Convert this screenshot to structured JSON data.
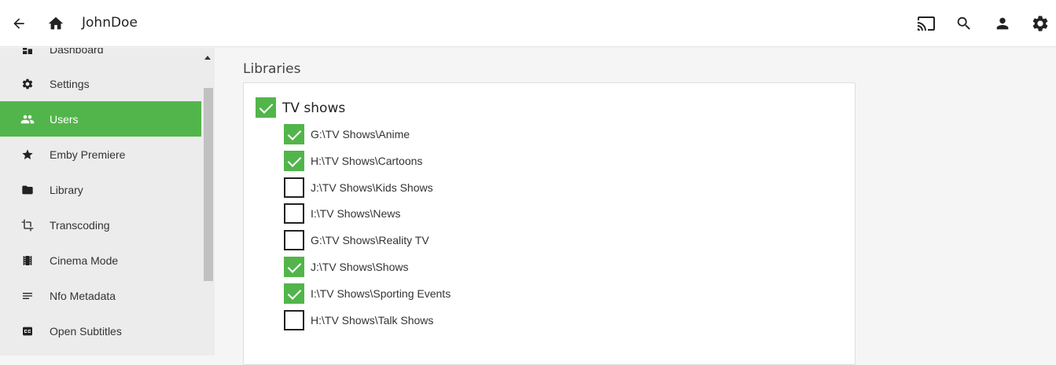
{
  "header": {
    "title": "JohnDoe",
    "icons": [
      "arrow-left-icon",
      "home-icon",
      "cast-icon",
      "search-icon",
      "person-icon",
      "gear-icon"
    ]
  },
  "sidebar": {
    "items": [
      {
        "label": "Dashboard",
        "icon": "dashboard-icon"
      },
      {
        "label": "Settings",
        "icon": "gear-icon"
      },
      {
        "label": "Users",
        "icon": "people-icon",
        "active": true
      },
      {
        "label": "Emby Premiere",
        "icon": "star-icon"
      },
      {
        "label": "Library",
        "icon": "folder-icon"
      },
      {
        "label": "Transcoding",
        "icon": "crop-icon"
      },
      {
        "label": "Cinema Mode",
        "icon": "film-icon"
      },
      {
        "label": "Nfo Metadata",
        "icon": "lines-icon"
      },
      {
        "label": "Open Subtitles",
        "icon": "cc-icon"
      }
    ]
  },
  "main": {
    "section_title": "Libraries",
    "group": {
      "label": "TV shows",
      "checked": true
    },
    "libraries": [
      {
        "label": "G:\\TV Shows\\Anime",
        "checked": true
      },
      {
        "label": "H:\\TV Shows\\Cartoons",
        "checked": true
      },
      {
        "label": "J:\\TV Shows\\Kids Shows",
        "checked": false
      },
      {
        "label": "I:\\TV Shows\\News",
        "checked": false
      },
      {
        "label": "G:\\TV Shows\\Reality TV",
        "checked": false
      },
      {
        "label": "J:\\TV Shows\\Shows",
        "checked": true
      },
      {
        "label": "I:\\TV Shows\\Sporting Events",
        "checked": true
      },
      {
        "label": "H:\\TV Shows\\Talk Shows",
        "checked": false
      }
    ]
  },
  "colors": {
    "accent": "#52b54b"
  }
}
